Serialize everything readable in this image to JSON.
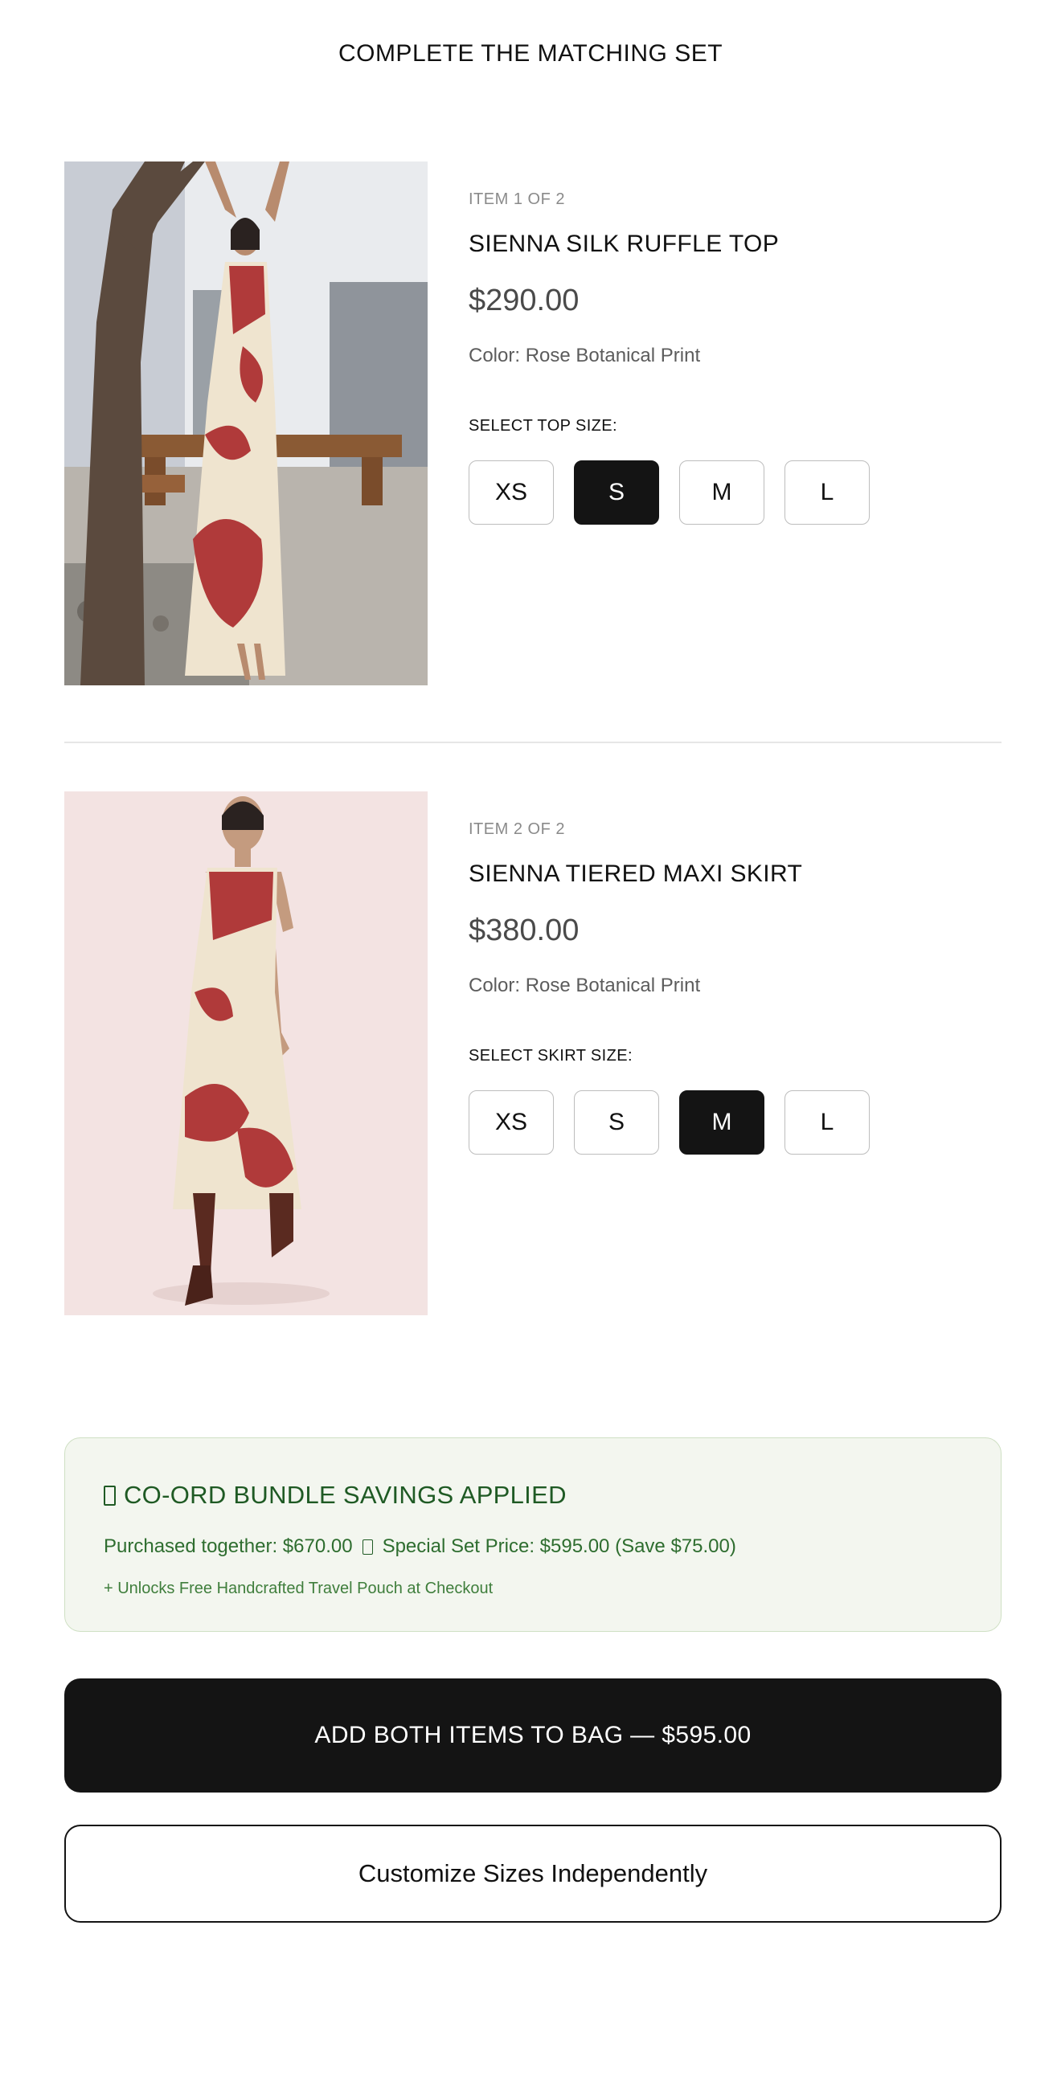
{
  "page": {
    "title": "COMPLETE THE MATCHING SET"
  },
  "items": [
    {
      "count": "ITEM 1 OF 2",
      "name": "SIENNA SILK RUFFLE TOP",
      "price": "$290.00",
      "color": "Color: Rose Botanical Print",
      "size_label": "SELECT TOP SIZE:",
      "sizes": [
        "XS",
        "S",
        "M",
        "L"
      ],
      "selected_size": "S"
    },
    {
      "count": "ITEM 2 OF 2",
      "name": "SIENNA TIERED MAXI SKIRT",
      "price": "$380.00",
      "color": "Color: Rose Botanical Print",
      "size_label": "SELECT SKIRT SIZE:",
      "sizes": [
        "XS",
        "S",
        "M",
        "L"
      ],
      "selected_size": "M"
    }
  ],
  "bundle": {
    "title": "CO-ORD BUNDLE SAVINGS APPLIED",
    "purchased_together": "Purchased together: $670.00",
    "special_price": "Special Set Price: $595.00 (Save $75.00)",
    "note": "+ Unlocks Free Handcrafted Travel Pouch at Checkout"
  },
  "actions": {
    "add_both": "ADD BOTH ITEMS TO BAG — $595.00",
    "customize": "Customize Sizes Independently"
  },
  "colors": {
    "accent_dark": "#141414",
    "bundle_bg": "#f3f6ef",
    "bundle_text": "#1f5a24",
    "print_red": "#b03a3a",
    "print_cream": "#efe4cf"
  }
}
